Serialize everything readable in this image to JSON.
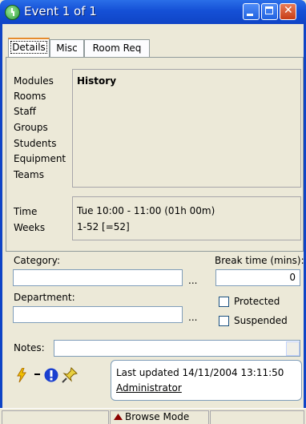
{
  "window": {
    "title": "Event 1 of 1"
  },
  "tabs": [
    {
      "label": "Details"
    },
    {
      "label": "Misc"
    },
    {
      "label": "Room Req"
    }
  ],
  "resources": {
    "items": [
      "Modules",
      "Rooms",
      "Staff",
      "Groups",
      "Students",
      "Equipment",
      "Teams"
    ],
    "history_label": "History"
  },
  "schedule": {
    "time_label": "Time",
    "weeks_label": "Weeks",
    "time_value": "Tue 10:00 - 11:00 (01h 00m)",
    "weeks_value": "1-52 [=52]"
  },
  "form": {
    "category_label": "Category:",
    "category_value": "",
    "break_label": "Break time (mins):",
    "break_value": "0",
    "department_label": "Department:",
    "department_value": "",
    "protected_label": "Protected",
    "suspended_label": "Suspended",
    "notes_label": "Notes:",
    "notes_value": "",
    "ellipsis": "..."
  },
  "info": {
    "updated_text": "Last updated 14/11/2004 13:11:50",
    "user": "Administrator"
  },
  "icons": [
    "lightning-icon",
    "dropdown-arrow-icon",
    "alert-icon",
    "pin-icon"
  ],
  "status": {
    "mode": "Browse Mode"
  },
  "colors": {
    "titlebar": "#1550d6",
    "window_bg": "#ece9d8",
    "active_tab": "#e68b2c"
  }
}
